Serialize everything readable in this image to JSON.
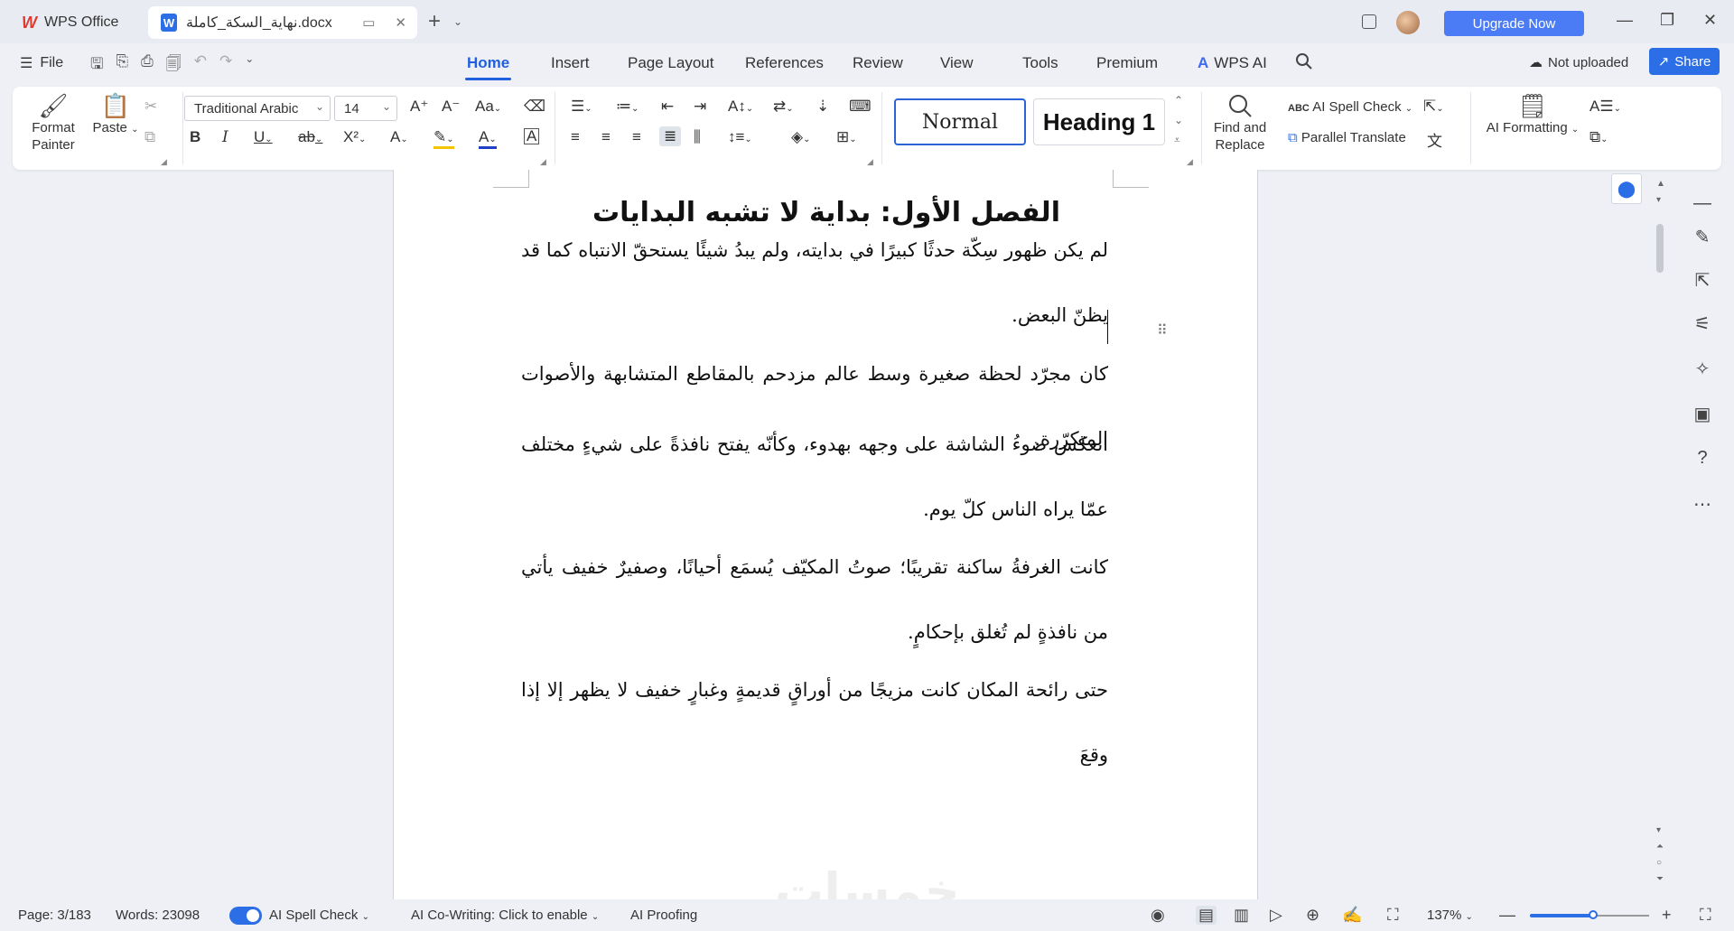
{
  "titlebar": {
    "app_tab": "WPS Office",
    "doc_tab": "نهاية_السكة_كاملة.docx",
    "upgrade": "Upgrade Now"
  },
  "menubar": {
    "file": "File",
    "tabs": [
      "Home",
      "Insert",
      "Page Layout",
      "References",
      "Review",
      "View",
      "Tools",
      "Premium",
      "WPS AI"
    ],
    "not_uploaded": "Not uploaded",
    "share": "Share"
  },
  "ribbon": {
    "format_painter": "Format Painter",
    "paste": "Paste",
    "font": "Traditional Arabic",
    "font_size": "14",
    "style_normal": "Normal",
    "style_heading": "Heading 1",
    "find_replace": "Find and Replace",
    "ai_spell_check": "AI Spell Check",
    "parallel_translate": "Parallel Translate",
    "ai_formatting": "AI Formatting"
  },
  "document": {
    "title": "الفصل الأول: بداية لا تشبه البدايات",
    "paragraphs": [
      "لم يكن ظهور سِكّة حدثًا كبيرًا في بدايته، ولم يبدُ شيئًا يستحقّ الانتباه كما قد يظنّ البعض.",
      "كان مجرّد لحظة صغيرة وسط عالم مزدحم بالمقاطع المتشابهة والأصوات المتكرّرة.",
      "انعكس ضوءُ الشاشة على وجهه بهدوء، وكأنّه يفتح نافذةً على شيءٍ مختلف عمّا يراه الناس كلّ يوم.",
      "كانت الغرفةُ ساكنة تقريبًا؛ صوتُ المكيّف يُسمَع أحيانًا، وصفيرٌ خفيف يأتي من نافذةٍ لم تُغلق بإحكامٍ.",
      "حتى رائحة المكان كانت مزيجًا من أوراقٍ قديمةٍ وغبارٍ خفيف لا يظهر إلا إذا وقعَ"
    ],
    "watermark": "خمسات"
  },
  "statusbar": {
    "page": "Page: 3/183",
    "words": "Words: 23098",
    "ai_spell_check": "AI Spell Check",
    "ai_cowriting": "AI Co-Writing: Click to enable",
    "ai_proofing": "AI Proofing",
    "zoom": "137%",
    "zoom_level": 0.53
  },
  "colors": {
    "accent": "#2b6ee6",
    "brand_red": "#e03a2f",
    "upgrade": "#4c7cf5"
  }
}
